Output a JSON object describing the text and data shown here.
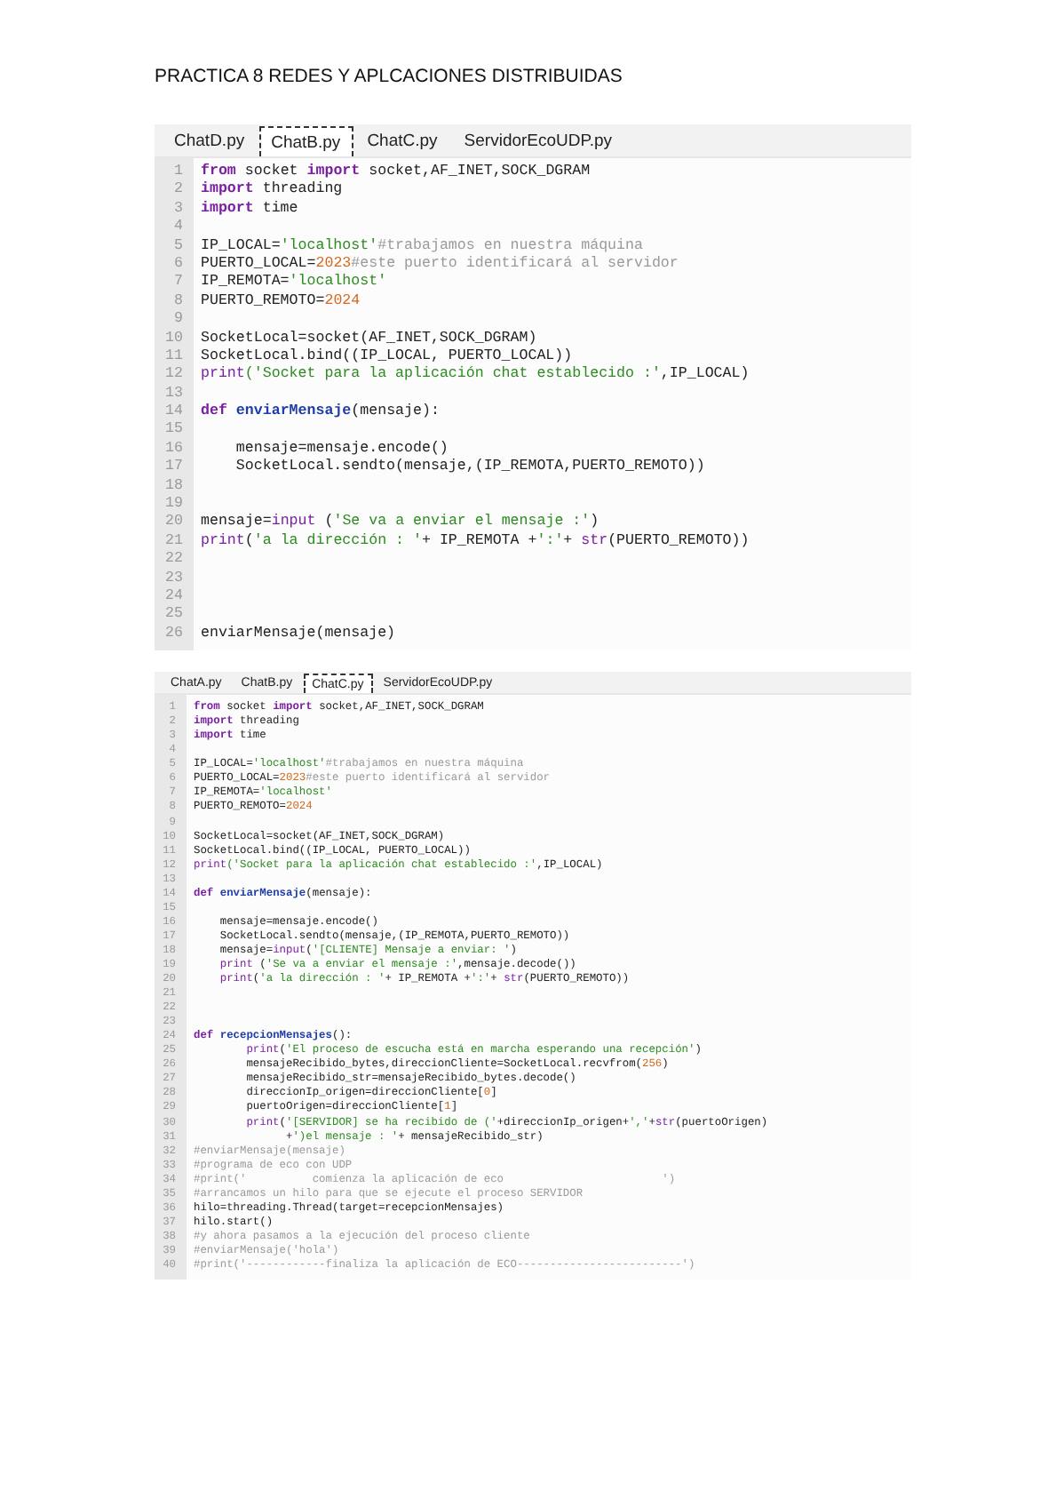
{
  "title": "PRACTICA 8 REDES Y APLCACIONES DISTRIBUIDAS",
  "editors": [
    {
      "tabs": [
        {
          "label": "ChatD.py",
          "selected": false
        },
        {
          "label": "ChatB.py",
          "selected": true
        },
        {
          "label": "ChatC.py",
          "selected": false
        },
        {
          "label": "ServidorEcoUDP.py",
          "selected": false
        }
      ],
      "lines": [
        {
          "n": "1",
          "code": [
            {
              "kind": "kw",
              "text": "from"
            },
            {
              "kind": "p",
              "text": " socket "
            },
            {
              "kind": "kw",
              "text": "import"
            },
            {
              "kind": "p",
              "text": " socket,AF_INET,SOCK_DGRAM"
            }
          ]
        },
        {
          "n": "2",
          "code": [
            {
              "kind": "kw",
              "text": "import"
            },
            {
              "kind": "p",
              "text": " threading"
            }
          ]
        },
        {
          "n": "3",
          "code": [
            {
              "kind": "kw",
              "text": "import"
            },
            {
              "kind": "p",
              "text": " time"
            }
          ]
        },
        {
          "n": "4"
        },
        {
          "n": "5",
          "code": [
            {
              "kind": "p",
              "text": "IP_LOCAL="
            },
            {
              "kind": "str",
              "text": "'localhost'"
            },
            {
              "kind": "com",
              "text": "#trabajamos en nuestra máquina"
            }
          ]
        },
        {
          "n": "6",
          "code": [
            {
              "kind": "p",
              "text": "PUERTO_LOCAL="
            },
            {
              "kind": "num",
              "text": "2023"
            },
            {
              "kind": "com",
              "text": "#este puerto identificará al servidor"
            }
          ]
        },
        {
          "n": "7",
          "code": [
            {
              "kind": "p",
              "text": "IP_REMOTA="
            },
            {
              "kind": "str",
              "text": "'localhost'"
            }
          ]
        },
        {
          "n": "8",
          "code": [
            {
              "kind": "p",
              "text": "PUERTO_REMOTO="
            },
            {
              "kind": "num",
              "text": "2024"
            }
          ]
        },
        {
          "n": "9"
        },
        {
          "n": "10",
          "code": [
            {
              "kind": "p",
              "text": "SocketLocal=socket(AF_INET,SOCK_DGRAM)"
            }
          ]
        },
        {
          "n": "11",
          "code": [
            {
              "kind": "p",
              "text": "SocketLocal.bind((IP_LOCAL, PUERTO_LOCAL))"
            }
          ]
        },
        {
          "n": "12",
          "code": [
            {
              "kind": "fn",
              "text": "print"
            },
            {
              "kind": "str",
              "text": "('Socket para la aplicación chat establecido :'"
            },
            {
              "kind": "p",
              "text": ",IP_LOCAL)"
            }
          ]
        },
        {
          "n": "13"
        },
        {
          "n": "14",
          "code": [
            {
              "kind": "kw",
              "text": "def "
            },
            {
              "kind": "def",
              "text": "enviarMensaje"
            },
            {
              "kind": "p",
              "text": "(mensaje):"
            }
          ]
        },
        {
          "n": "15"
        },
        {
          "n": "16",
          "code": [
            {
              "kind": "p",
              "text": "    mensaje=mensaje.encode()"
            }
          ]
        },
        {
          "n": "17",
          "code": [
            {
              "kind": "p",
              "text": "    SocketLocal.sendto(mensaje,(IP_REMOTA,PUERTO_REMOTO))"
            }
          ]
        },
        {
          "n": "18"
        },
        {
          "n": "19"
        },
        {
          "n": "20",
          "code": [
            {
              "kind": "p",
              "text": "mensaje="
            },
            {
              "kind": "fn",
              "text": "input"
            },
            {
              "kind": "p",
              "text": " ("
            },
            {
              "kind": "str",
              "text": "'Se va a enviar el mensaje :'"
            },
            {
              "kind": "p",
              "text": ")"
            }
          ]
        },
        {
          "n": "21",
          "code": [
            {
              "kind": "fn",
              "text": "print"
            },
            {
              "kind": "p",
              "text": "("
            },
            {
              "kind": "str",
              "text": "'a la dirección : '"
            },
            {
              "kind": "p",
              "text": "+ IP_REMOTA +"
            },
            {
              "kind": "str",
              "text": "':'"
            },
            {
              "kind": "p",
              "text": "+ "
            },
            {
              "kind": "fn",
              "text": "str"
            },
            {
              "kind": "p",
              "text": "(PUERTO_REMOTO))"
            }
          ]
        },
        {
          "n": "22"
        },
        {
          "n": "23"
        },
        {
          "n": "24"
        },
        {
          "n": "25"
        },
        {
          "n": "26",
          "code": [
            {
              "kind": "p",
              "text": "enviarMensaje(mensaje)"
            }
          ]
        }
      ]
    },
    {
      "tabs": [
        {
          "label": "ChatA.py",
          "selected": false
        },
        {
          "label": "ChatB.py",
          "selected": false
        },
        {
          "label": "ChatC.py",
          "selected": true
        },
        {
          "label": "ServidorEcoUDP.py",
          "selected": false
        }
      ],
      "lines": [
        {
          "n": "1",
          "code": [
            {
              "kind": "kw",
              "text": "from"
            },
            {
              "kind": "p",
              "text": " socket "
            },
            {
              "kind": "kw",
              "text": "import"
            },
            {
              "kind": "p",
              "text": " socket,AF_INET,SOCK_DGRAM"
            }
          ]
        },
        {
          "n": "2",
          "code": [
            {
              "kind": "kw",
              "text": "import"
            },
            {
              "kind": "p",
              "text": " threading"
            }
          ]
        },
        {
          "n": "3",
          "code": [
            {
              "kind": "kw",
              "text": "import"
            },
            {
              "kind": "p",
              "text": " time"
            }
          ]
        },
        {
          "n": "4"
        },
        {
          "n": "5",
          "code": [
            {
              "kind": "p",
              "text": "IP_LOCAL="
            },
            {
              "kind": "str",
              "text": "'localhost'"
            },
            {
              "kind": "com",
              "text": "#trabajamos en nuestra máquina"
            }
          ]
        },
        {
          "n": "6",
          "code": [
            {
              "kind": "p",
              "text": "PUERTO_LOCAL="
            },
            {
              "kind": "num",
              "text": "2023"
            },
            {
              "kind": "com",
              "text": "#este puerto identificará al servidor"
            }
          ]
        },
        {
          "n": "7",
          "code": [
            {
              "kind": "p",
              "text": "IP_REMOTA="
            },
            {
              "kind": "str",
              "text": "'localhost'"
            }
          ]
        },
        {
          "n": "8",
          "code": [
            {
              "kind": "p",
              "text": "PUERTO_REMOTO="
            },
            {
              "kind": "num",
              "text": "2024"
            }
          ]
        },
        {
          "n": "9"
        },
        {
          "n": "10",
          "code": [
            {
              "kind": "p",
              "text": "SocketLocal=socket(AF_INET,SOCK_DGRAM)"
            }
          ]
        },
        {
          "n": "11",
          "code": [
            {
              "kind": "p",
              "text": "SocketLocal.bind((IP_LOCAL, PUERTO_LOCAL))"
            }
          ]
        },
        {
          "n": "12",
          "code": [
            {
              "kind": "fn",
              "text": "print"
            },
            {
              "kind": "str",
              "text": "('Socket para la aplicación chat establecido :'"
            },
            {
              "kind": "p",
              "text": ",IP_LOCAL)"
            }
          ]
        },
        {
          "n": "13"
        },
        {
          "n": "14",
          "code": [
            {
              "kind": "kw",
              "text": "def "
            },
            {
              "kind": "def",
              "text": "enviarMensaje"
            },
            {
              "kind": "p",
              "text": "(mensaje):"
            }
          ]
        },
        {
          "n": "15"
        },
        {
          "n": "16",
          "code": [
            {
              "kind": "p",
              "text": "    mensaje=mensaje.encode()"
            }
          ]
        },
        {
          "n": "17",
          "code": [
            {
              "kind": "p",
              "text": "    SocketLocal.sendto(mensaje,(IP_REMOTA,PUERTO_REMOTO))"
            }
          ]
        },
        {
          "n": "18",
          "code": [
            {
              "kind": "p",
              "text": "    mensaje="
            },
            {
              "kind": "fn",
              "text": "input"
            },
            {
              "kind": "p",
              "text": "("
            },
            {
              "kind": "str",
              "text": "'[CLIENTE] Mensaje a enviar: '"
            },
            {
              "kind": "p",
              "text": ")"
            }
          ]
        },
        {
          "n": "19",
          "code": [
            {
              "kind": "fn",
              "text": "    print"
            },
            {
              "kind": "p",
              "text": " ("
            },
            {
              "kind": "str",
              "text": "'Se va a enviar el mensaje :'"
            },
            {
              "kind": "p",
              "text": ",mensaje.decode())"
            }
          ]
        },
        {
          "n": "20",
          "code": [
            {
              "kind": "fn",
              "text": "    print"
            },
            {
              "kind": "p",
              "text": "("
            },
            {
              "kind": "str",
              "text": "'a la dirección : '"
            },
            {
              "kind": "p",
              "text": "+ IP_REMOTA +"
            },
            {
              "kind": "str",
              "text": "':'"
            },
            {
              "kind": "p",
              "text": "+ "
            },
            {
              "kind": "fn",
              "text": "str"
            },
            {
              "kind": "p",
              "text": "(PUERTO_REMOTO))"
            }
          ]
        },
        {
          "n": "21"
        },
        {
          "n": "22"
        },
        {
          "n": "23"
        },
        {
          "n": "24",
          "code": [
            {
              "kind": "kw",
              "text": "def "
            },
            {
              "kind": "def",
              "text": "recepcionMensajes"
            },
            {
              "kind": "p",
              "text": "():"
            }
          ]
        },
        {
          "n": "25",
          "code": [
            {
              "kind": "fn",
              "text": "        print"
            },
            {
              "kind": "p",
              "text": "("
            },
            {
              "kind": "str",
              "text": "'El proceso de escucha está en marcha esperando una recepción'"
            },
            {
              "kind": "p",
              "text": ")"
            }
          ]
        },
        {
          "n": "26",
          "code": [
            {
              "kind": "p",
              "text": "        mensajeRecibido_bytes,direccionCliente=SocketLocal.recvfrom("
            },
            {
              "kind": "num",
              "text": "256"
            },
            {
              "kind": "p",
              "text": ")"
            }
          ]
        },
        {
          "n": "27",
          "code": [
            {
              "kind": "p",
              "text": "        mensajeRecibido_str=mensajeRecibido_bytes.decode()"
            }
          ]
        },
        {
          "n": "28",
          "code": [
            {
              "kind": "p",
              "text": "        direccionIp_origen=direccionCliente["
            },
            {
              "kind": "num",
              "text": "0"
            },
            {
              "kind": "p",
              "text": "]"
            }
          ]
        },
        {
          "n": "29",
          "code": [
            {
              "kind": "p",
              "text": "        puertoOrigen=direccionCliente["
            },
            {
              "kind": "num",
              "text": "1"
            },
            {
              "kind": "p",
              "text": "]"
            }
          ]
        },
        {
          "n": "30",
          "code": [
            {
              "kind": "fn",
              "text": "        print"
            },
            {
              "kind": "p",
              "text": "("
            },
            {
              "kind": "str",
              "text": "'[SERVIDOR] se ha recibido de ('"
            },
            {
              "kind": "p",
              "text": "+direccionIp_origen+"
            },
            {
              "kind": "str",
              "text": "','"
            },
            {
              "kind": "p",
              "text": "+"
            },
            {
              "kind": "fn",
              "text": "str"
            },
            {
              "kind": "p",
              "text": "(puertoOrigen)"
            }
          ]
        },
        {
          "n": "31",
          "code": [
            {
              "kind": "p",
              "text": "              +"
            },
            {
              "kind": "str",
              "text": "')el mensaje : '"
            },
            {
              "kind": "p",
              "text": "+ mensajeRecibido_str)"
            }
          ]
        },
        {
          "n": "32",
          "code": [
            {
              "kind": "com",
              "text": "#enviarMensaje(mensaje)"
            }
          ]
        },
        {
          "n": "33",
          "code": [
            {
              "kind": "com",
              "text": "#programa de eco con UDP"
            }
          ]
        },
        {
          "n": "34",
          "code": [
            {
              "kind": "com",
              "text": "#print('          comienza la aplicación de eco                        ')"
            }
          ]
        },
        {
          "n": "35",
          "code": [
            {
              "kind": "com",
              "text": "#arrancamos un hilo para que se ejecute el proceso SERVIDOR"
            }
          ]
        },
        {
          "n": "36",
          "code": [
            {
              "kind": "p",
              "text": "hilo=threading.Thread(target=recepcionMensajes)"
            }
          ]
        },
        {
          "n": "37",
          "code": [
            {
              "kind": "p",
              "text": "hilo.start()"
            }
          ]
        },
        {
          "n": "38",
          "code": [
            {
              "kind": "com",
              "text": "#y ahora pasamos a la ejecución del proceso cliente"
            }
          ]
        },
        {
          "n": "39",
          "code": [
            {
              "kind": "com",
              "text": "#enviarMensaje('hola')"
            }
          ]
        },
        {
          "n": "40",
          "code": [
            {
              "kind": "com",
              "text": "#print('------------finaliza la aplicación de ECO-------------------------')"
            }
          ]
        }
      ]
    }
  ]
}
